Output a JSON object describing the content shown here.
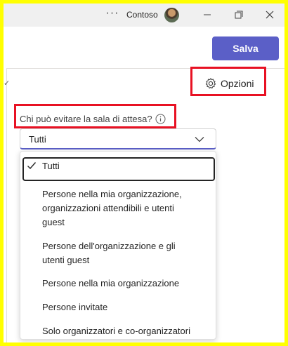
{
  "titlebar": {
    "org_name": "Contoso",
    "more_label": "···"
  },
  "toolbar": {
    "save_label": "Salva"
  },
  "options": {
    "label": "Opzioni"
  },
  "lobby": {
    "question": "Chi può evitare la sala di attesa?",
    "selected_value": "Tutti",
    "options": [
      {
        "lines": [
          "Tutti"
        ],
        "selected": true
      },
      {
        "lines": [
          "Persone nella mia organizzazione,",
          "organizzazioni attendibili e utenti",
          "guest"
        ],
        "selected": false
      },
      {
        "lines": [
          "Persone dell'organizzazione e gli",
          "utenti guest"
        ],
        "selected": false
      },
      {
        "lines": [
          "Persone nella mia organizzazione"
        ],
        "selected": false
      },
      {
        "lines": [
          "Persone invitate"
        ],
        "selected": false
      },
      {
        "lines": [
          "Solo organizzatori e co-organizzatori"
        ],
        "selected": false
      }
    ]
  },
  "colors": {
    "accent": "#5b5fc7",
    "highlight": "#e81123",
    "outer_border": "#ffff00"
  },
  "icons": [
    "more-icon",
    "avatar",
    "minimize-icon",
    "restore-icon",
    "close-icon",
    "gear-icon",
    "info-icon",
    "chevron-down-icon",
    "checkmark-icon"
  ]
}
